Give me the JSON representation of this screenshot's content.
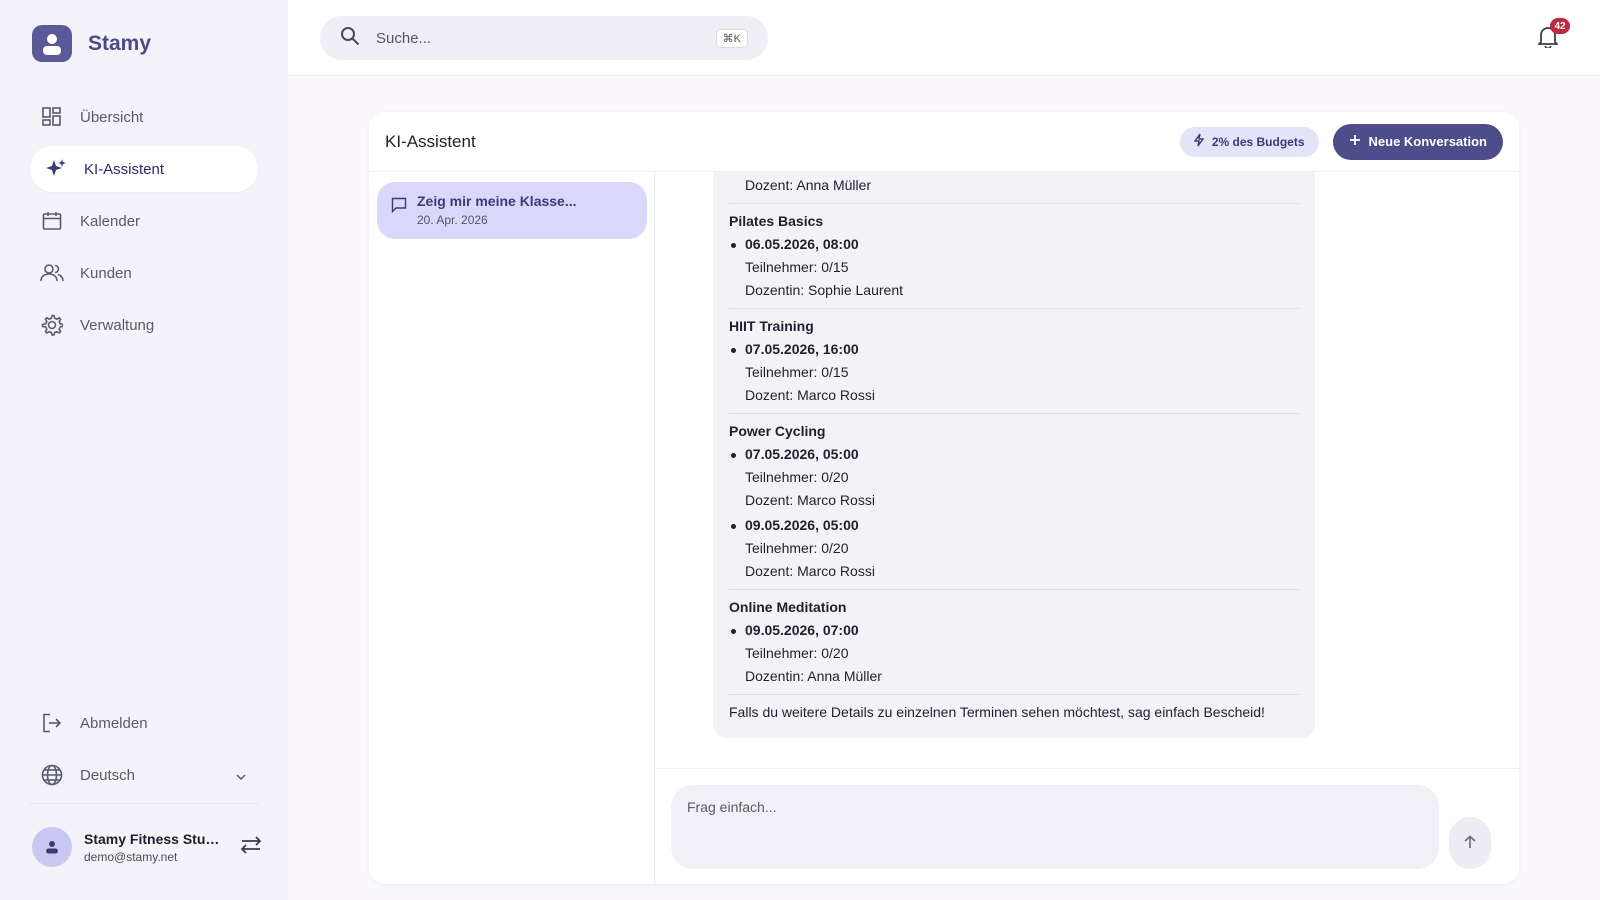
{
  "brand": {
    "name": "Stamy"
  },
  "nav": [
    {
      "label": "Übersicht",
      "icon": "dashboard-icon",
      "active": false
    },
    {
      "label": "KI-Assistent",
      "icon": "sparkle-icon",
      "active": true
    },
    {
      "label": "Kalender",
      "icon": "calendar-icon",
      "active": false
    },
    {
      "label": "Kunden",
      "icon": "users-icon",
      "active": false
    },
    {
      "label": "Verwaltung",
      "icon": "gear-icon",
      "active": false
    }
  ],
  "bottom_nav": {
    "logout_label": "Abmelden",
    "language_label": "Deutsch"
  },
  "user": {
    "name": "Stamy Fitness Studio",
    "email": "demo@stamy.net"
  },
  "search": {
    "placeholder": "Suche...",
    "shortcut": "⌘K"
  },
  "notifications": {
    "count": "42"
  },
  "assistant": {
    "title": "KI-Assistent",
    "budget_label": "2% des Budgets",
    "new_conversation_label": "Neue Konversation"
  },
  "conversations": [
    {
      "title": "Zeig mir meine Klasse...",
      "date": "20. Apr. 2026"
    }
  ],
  "message": {
    "top_line": "Dozent: Anna Müller",
    "courses": [
      {
        "name": "Pilates Basics",
        "sessions": [
          {
            "datetime": "06.05.2026, 08:00",
            "participants": "Teilnehmer: 0/15",
            "instructor": "Dozentin: Sophie Laurent"
          }
        ]
      },
      {
        "name": "HIIT Training",
        "sessions": [
          {
            "datetime": "07.05.2026, 16:00",
            "participants": "Teilnehmer: 0/15",
            "instructor": "Dozent: Marco Rossi"
          }
        ]
      },
      {
        "name": "Power Cycling",
        "sessions": [
          {
            "datetime": "07.05.2026, 05:00",
            "participants": "Teilnehmer: 0/20",
            "instructor": "Dozent: Marco Rossi"
          },
          {
            "datetime": "09.05.2026, 05:00",
            "participants": "Teilnehmer: 0/20",
            "instructor": "Dozent: Marco Rossi"
          }
        ]
      },
      {
        "name": "Online Meditation",
        "sessions": [
          {
            "datetime": "09.05.2026, 07:00",
            "participants": "Teilnehmer: 0/20",
            "instructor": "Dozentin: Anna Müller"
          }
        ]
      }
    ],
    "closing": "Falls du weitere Details zu einzelnen Terminen sehen möchtest, sag einfach Bescheid!"
  },
  "composer": {
    "placeholder": "Frag einfach..."
  },
  "colors": {
    "accent": "#4e4d8c",
    "active_conv": "#d9d8fb",
    "badge": "#c0283f"
  }
}
